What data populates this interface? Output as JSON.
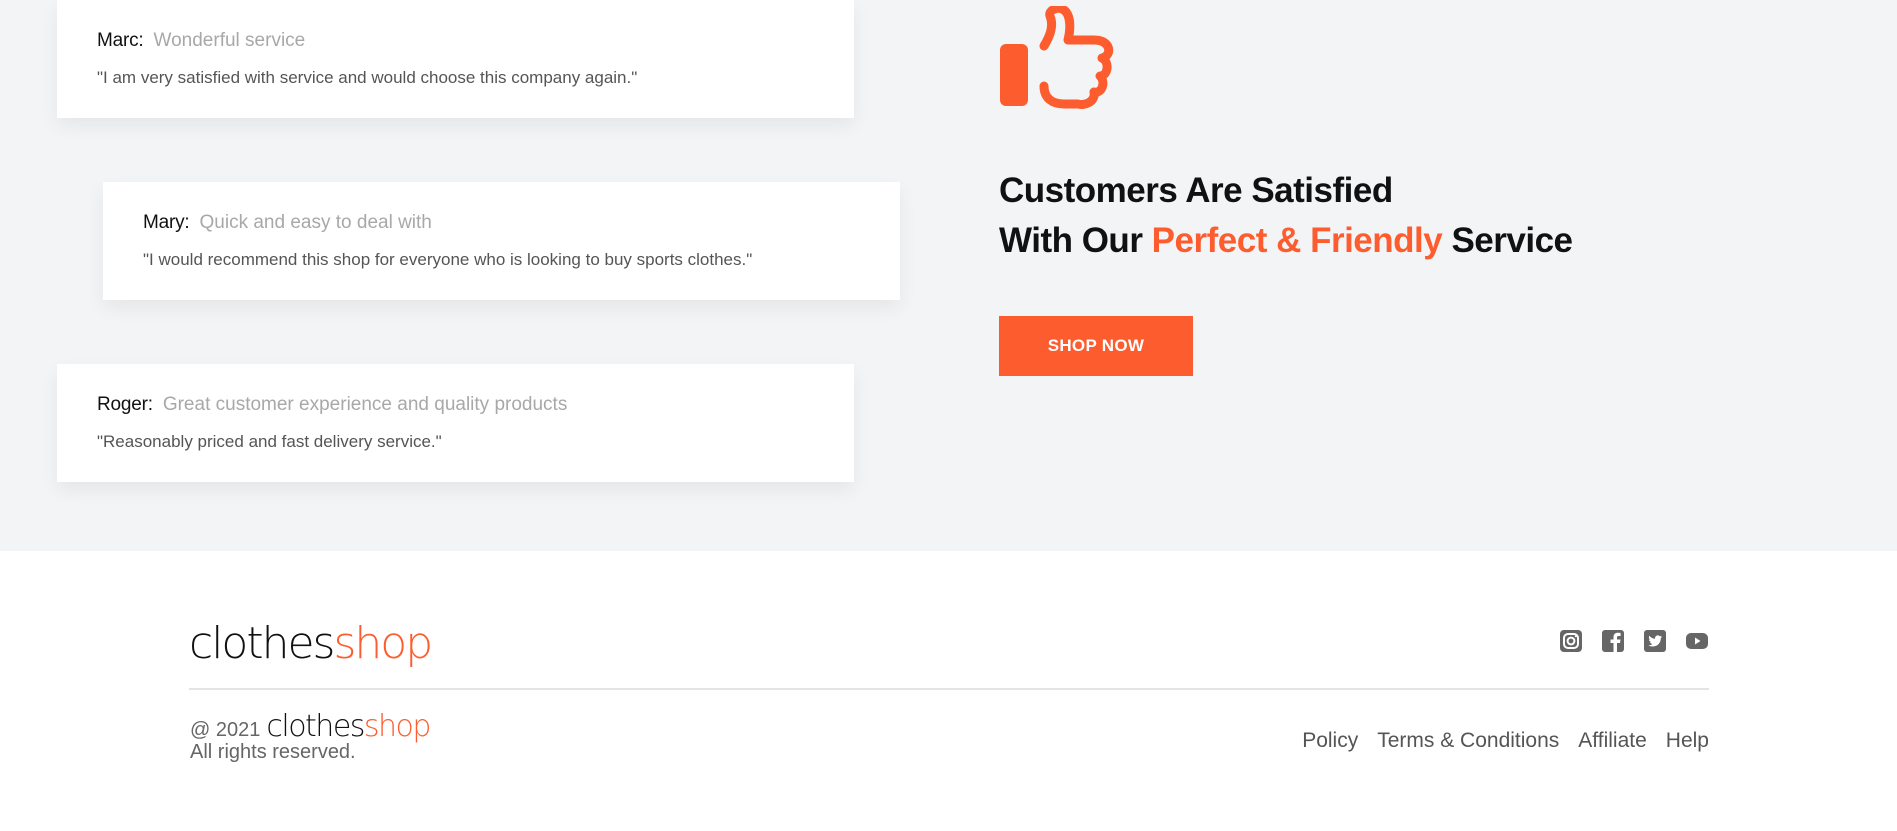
{
  "reviews": [
    {
      "name": "Marc:",
      "title": "Wonderful service",
      "quote": "\"I am very satisfied with service and would choose this company again.\""
    },
    {
      "name": "Mary:",
      "title": "Quick and easy to deal with",
      "quote": "\"I would recommend this shop for everyone who is looking to buy sports clothes.\""
    },
    {
      "name": "Roger:",
      "title": "Great customer experience and quality products",
      "quote": "\"Reasonably priced and fast delivery service.\""
    }
  ],
  "headline": {
    "line1": "Customers Are Satisfied",
    "line2_prefix": "With Our ",
    "line2_accent": "Perfect & Friendly",
    "line2_suffix": " Service"
  },
  "cta": {
    "label": "SHOP NOW"
  },
  "brand": {
    "part1": "clothes",
    "part2": "shop"
  },
  "footer": {
    "copyright_prefix": "@ 2021",
    "rights": "All rights reserved.",
    "links": [
      "Policy",
      "Terms & Conditions",
      "Affiliate",
      "Help"
    ],
    "social_icons": [
      "instagram-icon",
      "facebook-icon",
      "twitter-icon",
      "youtube-icon"
    ]
  },
  "colors": {
    "accent": "#fd5d2e",
    "section_bg": "#f3f4f6",
    "icon_gray": "#666666"
  }
}
